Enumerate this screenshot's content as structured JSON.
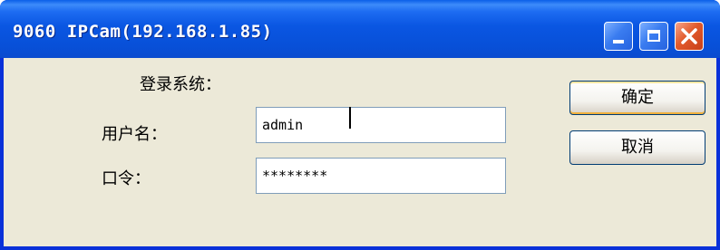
{
  "window": {
    "title": "9060 IPCam(192.168.1.85)",
    "title_bar_color": "#0a56e2",
    "close_button_color": "#e25a2b"
  },
  "titlebar_controls": {
    "minimize_icon": "minimize-icon",
    "maximize_icon": "maximize-icon",
    "close_icon": "close-icon"
  },
  "form": {
    "heading": "登录系统：",
    "username_label": "用户名：",
    "username_value": "admin",
    "password_label": "口令：",
    "password_value": "********"
  },
  "buttons": {
    "ok_label": "确定",
    "cancel_label": "取消"
  }
}
